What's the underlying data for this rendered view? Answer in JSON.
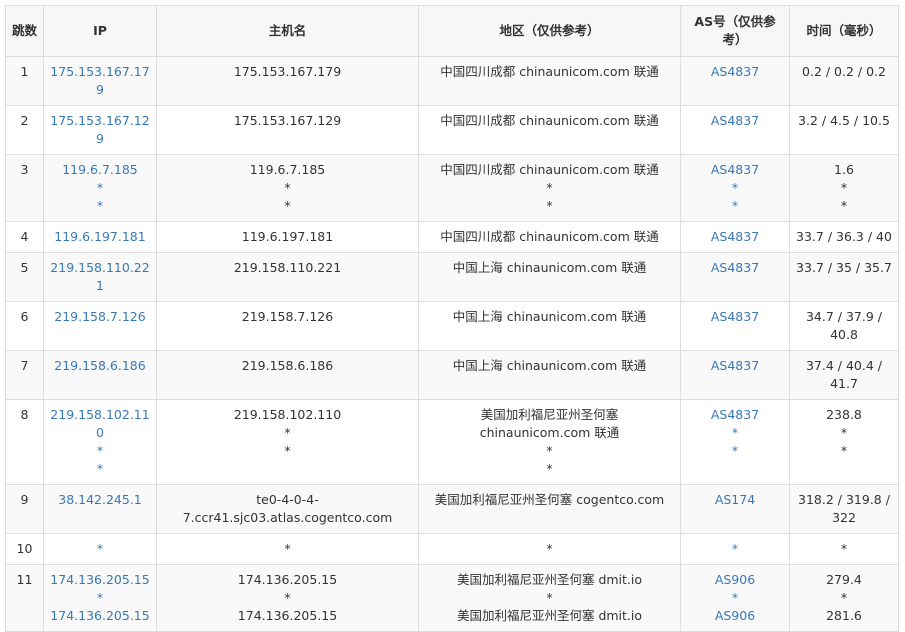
{
  "headers": [
    "跳数",
    "IP",
    "主机名",
    "地区（仅供参考）",
    "AS号（仅供参考）",
    "时间（毫秒）"
  ],
  "rows": [
    {
      "hop": "1",
      "ip": [
        "175.153.167.179"
      ],
      "host": [
        "175.153.167.179"
      ],
      "region": [
        "中国四川成都 chinaunicom.com 联通"
      ],
      "as": [
        "AS4837"
      ],
      "time": [
        "0.2 / 0.2 / 0.2"
      ]
    },
    {
      "hop": "2",
      "ip": [
        "175.153.167.129"
      ],
      "host": [
        "175.153.167.129"
      ],
      "region": [
        "中国四川成都 chinaunicom.com 联通"
      ],
      "as": [
        "AS4837"
      ],
      "time": [
        "3.2 / 4.5 / 10.5"
      ]
    },
    {
      "hop": "3",
      "ip": [
        "119.6.7.185",
        "*",
        "*"
      ],
      "host": [
        "119.6.7.185",
        "*",
        "*"
      ],
      "region": [
        "中国四川成都 chinaunicom.com 联通",
        "*",
        "*"
      ],
      "as": [
        "AS4837",
        "*",
        "*"
      ],
      "time": [
        "1.6",
        "*",
        "*"
      ]
    },
    {
      "hop": "4",
      "ip": [
        "119.6.197.181"
      ],
      "host": [
        "119.6.197.181"
      ],
      "region": [
        "中国四川成都 chinaunicom.com 联通"
      ],
      "as": [
        "AS4837"
      ],
      "time": [
        "33.7 / 36.3 / 40"
      ]
    },
    {
      "hop": "5",
      "ip": [
        "219.158.110.221"
      ],
      "host": [
        "219.158.110.221"
      ],
      "region": [
        "中国上海 chinaunicom.com 联通"
      ],
      "as": [
        "AS4837"
      ],
      "time": [
        "33.7 / 35 / 35.7"
      ]
    },
    {
      "hop": "6",
      "ip": [
        "219.158.7.126"
      ],
      "host": [
        "219.158.7.126"
      ],
      "region": [
        "中国上海 chinaunicom.com 联通"
      ],
      "as": [
        "AS4837"
      ],
      "time": [
        "34.7 / 37.9 / 40.8"
      ]
    },
    {
      "hop": "7",
      "ip": [
        "219.158.6.186"
      ],
      "host": [
        "219.158.6.186"
      ],
      "region": [
        "中国上海 chinaunicom.com 联通"
      ],
      "as": [
        "AS4837"
      ],
      "time": [
        "37.4 / 40.4 / 41.7"
      ]
    },
    {
      "hop": "8",
      "ip": [
        "219.158.102.110",
        "*",
        "*"
      ],
      "host": [
        "219.158.102.110",
        "*",
        "*"
      ],
      "region": [
        "美国加利福尼亚州圣何塞 chinaunicom.com 联通",
        "*",
        "*"
      ],
      "as": [
        "AS4837",
        "*",
        "*"
      ],
      "time": [
        "238.8",
        "*",
        "*"
      ]
    },
    {
      "hop": "9",
      "ip": [
        "38.142.245.1"
      ],
      "host": [
        "te0-4-0-4-7.ccr41.sjc03.atlas.cogentco.com"
      ],
      "region": [
        "美国加利福尼亚州圣何塞 cogentco.com"
      ],
      "as": [
        "AS174"
      ],
      "time": [
        "318.2 / 319.8 / 322"
      ]
    },
    {
      "hop": "10",
      "ip": [
        "*"
      ],
      "host": [
        "*"
      ],
      "region": [
        "*"
      ],
      "as": [
        "*"
      ],
      "time": [
        "*"
      ]
    },
    {
      "hop": "11",
      "ip": [
        "174.136.205.15",
        "*",
        "174.136.205.15"
      ],
      "host": [
        "174.136.205.15",
        "*",
        "174.136.205.15"
      ],
      "region": [
        "美国加利福尼亚州圣何塞 dmit.io",
        "*",
        "美国加利福尼亚州圣何塞 dmit.io"
      ],
      "as": [
        "AS906",
        "*",
        "AS906"
      ],
      "time": [
        "279.4",
        "*",
        "281.6"
      ]
    }
  ]
}
